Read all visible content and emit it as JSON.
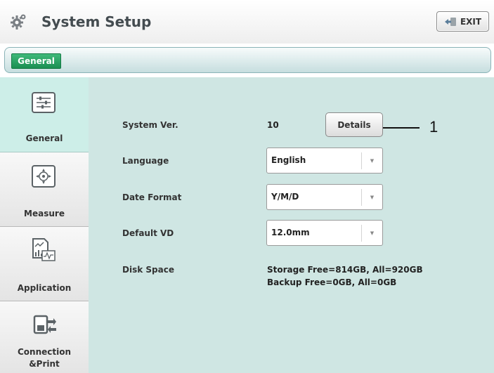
{
  "header": {
    "title": "System Setup",
    "exit_label": "EXIT",
    "icon": "gear-icon"
  },
  "tabs": [
    {
      "label": "General",
      "active": true
    }
  ],
  "sidebar": {
    "items": [
      {
        "label": "General",
        "icon": "sliders-icon",
        "active": true
      },
      {
        "label": "Measure",
        "icon": "target-icon",
        "active": false
      },
      {
        "label": "Application",
        "icon": "chart-icon",
        "active": false
      },
      {
        "label": "Connection\n&Print",
        "label_line1": "Connection",
        "label_line2": "&Print",
        "icon": "transfer-icon",
        "active": false
      }
    ]
  },
  "main": {
    "system_ver": {
      "label": "System Ver.",
      "value": "10",
      "details_label": "Details"
    },
    "language": {
      "label": "Language",
      "value": "English"
    },
    "date_format": {
      "label": "Date Format",
      "value": "Y/M/D"
    },
    "default_vd": {
      "label": "Default VD",
      "value": "12.0mm"
    },
    "disk_space": {
      "label": "Disk Space",
      "storage": "Storage Free=814GB, All=920GB",
      "backup": "Backup Free=0GB, All=0GB"
    }
  },
  "annotation": {
    "callout_number": "1"
  },
  "colors": {
    "accent_green": "#1b8f52",
    "main_bg": "#cfe6e3",
    "active_sidebar": "#cdeee8"
  }
}
